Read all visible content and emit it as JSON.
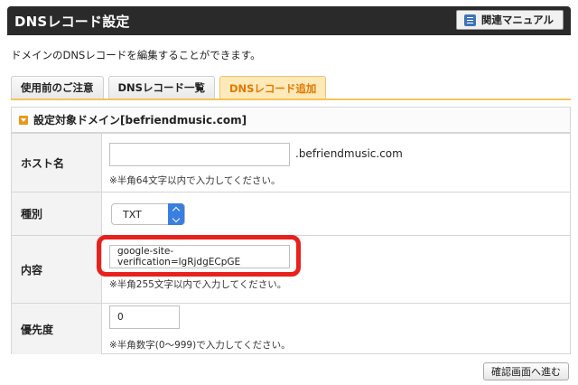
{
  "header": {
    "title": "DNSレコード設定",
    "manual_button": "関連マニュアル",
    "manual_icon": "book-icon"
  },
  "description": "ドメインのDNSレコードを編集することができます。",
  "tabs": [
    {
      "label": "使用前のご注意",
      "active": false
    },
    {
      "label": "DNSレコード一覧",
      "active": false
    },
    {
      "label": "DNSレコード追加",
      "active": true
    }
  ],
  "panel": {
    "title": "設定対象ドメイン[befriendmusic.com]",
    "host": {
      "label": "ホスト名",
      "value": "",
      "suffix": ".befriendmusic.com",
      "hint": "※半角64文字以内で入力してください。"
    },
    "type": {
      "label": "種別",
      "selected": "TXT"
    },
    "content": {
      "label": "内容",
      "value": "google-site-verification=lgRjdgECpGE",
      "hint": "※半角255文字以内で入力してください。"
    },
    "priority": {
      "label": "優先度",
      "value": "0",
      "hint": "※半角数字(0〜999)で入力してください。"
    }
  },
  "confirm_button": "確認画面へ進む",
  "colors": {
    "header_bg": "#2a2a2a",
    "active_tab_bg": "#ffe9b8",
    "active_tab_text": "#e07800",
    "highlight": "#e8211c",
    "select_accent": "#3a7ee0"
  }
}
